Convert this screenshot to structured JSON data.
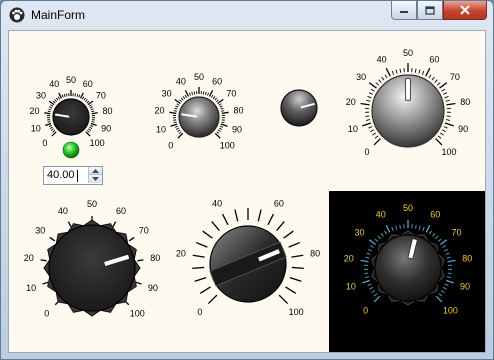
{
  "window": {
    "title": "MainForm",
    "icons": [
      "paw-icon",
      "minimize-icon",
      "maximize-icon",
      "close-icon"
    ]
  },
  "numeric_input": {
    "value": "40.00"
  },
  "indicator": {
    "state": "on",
    "color": "#22cc22"
  },
  "knobs": [
    {
      "name": "knob-1",
      "min": 0,
      "max": 100,
      "value": 20,
      "labels": [
        "0",
        "10",
        "20",
        "30",
        "40",
        "50",
        "60",
        "70",
        "80",
        "90",
        "100"
      ],
      "style": "textured-small"
    },
    {
      "name": "knob-2",
      "min": 0,
      "max": 100,
      "value": 20,
      "labels": [
        "0",
        "10",
        "20",
        "30",
        "40",
        "50",
        "60",
        "70",
        "80",
        "90",
        "100"
      ],
      "style": "metal"
    },
    {
      "name": "knob-3",
      "value": 75,
      "labels": [],
      "style": "plain"
    },
    {
      "name": "knob-4",
      "min": 0,
      "max": 100,
      "value": 50,
      "labels": [
        "0",
        "10",
        "20",
        "30",
        "40",
        "50",
        "60",
        "70",
        "80",
        "90",
        "100"
      ],
      "style": "large-metal"
    },
    {
      "name": "knob-5",
      "min": 0,
      "max": 100,
      "value": 77,
      "labels": [
        "0",
        "10",
        "20",
        "30",
        "40",
        "50",
        "60",
        "70",
        "80",
        "90",
        "100"
      ],
      "style": "serrated"
    },
    {
      "name": "knob-6",
      "min": 0,
      "max": 100,
      "value": 75,
      "labels": [
        "0",
        "20",
        "40",
        "60",
        "80",
        "100"
      ],
      "style": "ridge"
    },
    {
      "name": "knob-7",
      "min": 0,
      "max": 100,
      "value": 55,
      "labels": [
        "0",
        "10",
        "20",
        "30",
        "40",
        "50",
        "60",
        "70",
        "80",
        "90",
        "100"
      ],
      "style": "dark",
      "label_color": "#f0d000",
      "tick_color": "#3ab0d0"
    }
  ]
}
